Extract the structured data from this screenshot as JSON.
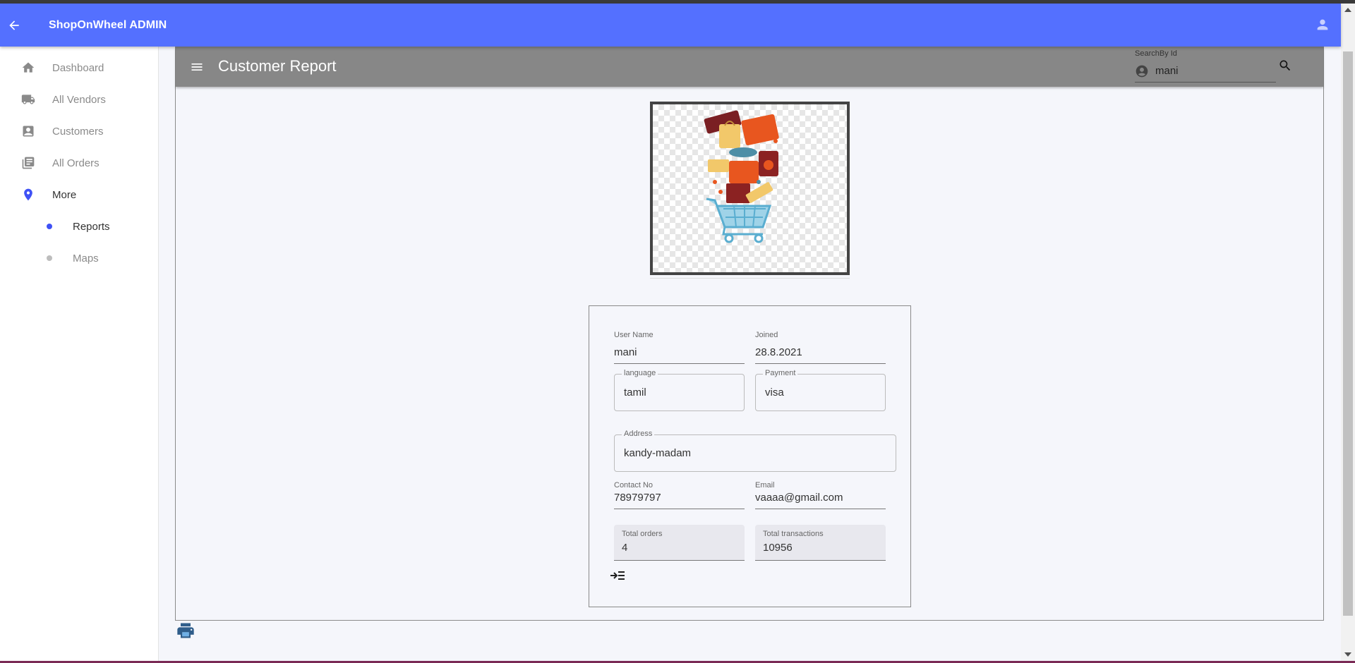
{
  "app": {
    "title": "ShopOnWheel ADMIN",
    "brand_color": "#5470ff"
  },
  "icons": {
    "back": "arrow-left-icon",
    "user": "account-icon",
    "menu": "hamburger-menu-icon",
    "search": "search-icon",
    "search_field": "account-circle-icon",
    "expand": "expand-indent-icon",
    "print": "printer-icon"
  },
  "sidebar": {
    "items": [
      {
        "label": "Dashboard",
        "icon": "home-icon"
      },
      {
        "label": "All Vendors",
        "icon": "truck-icon"
      },
      {
        "label": "Customers",
        "icon": "contact-card-icon"
      },
      {
        "label": "All Orders",
        "icon": "library-books-icon"
      },
      {
        "label": "More",
        "icon": "location-pin-icon"
      }
    ],
    "sub_items": [
      {
        "label": "Reports"
      },
      {
        "label": "Maps"
      }
    ],
    "active": "Reports"
  },
  "header": {
    "title": "Customer Report",
    "search": {
      "label": "SearchBy Id",
      "value": "mani"
    }
  },
  "customer": {
    "image_alt": "shopping cart with bags",
    "fields": {
      "user_name": {
        "label": "User Name",
        "value": "mani"
      },
      "joined": {
        "label": "Joined",
        "value": "28.8.2021"
      },
      "language": {
        "label": "language",
        "value": "tamil"
      },
      "payment": {
        "label": "Payment",
        "value": "visa"
      },
      "address": {
        "label": "Address",
        "value": "kandy-madam"
      },
      "contact": {
        "label": "Contact No",
        "value": "78979797"
      },
      "email": {
        "label": "Email",
        "value": "vaaaa@gmail.com"
      },
      "total_orders": {
        "label": "Total orders",
        "value": "4"
      },
      "total_transactions": {
        "label": "Total transactions",
        "value": "10956"
      }
    }
  }
}
